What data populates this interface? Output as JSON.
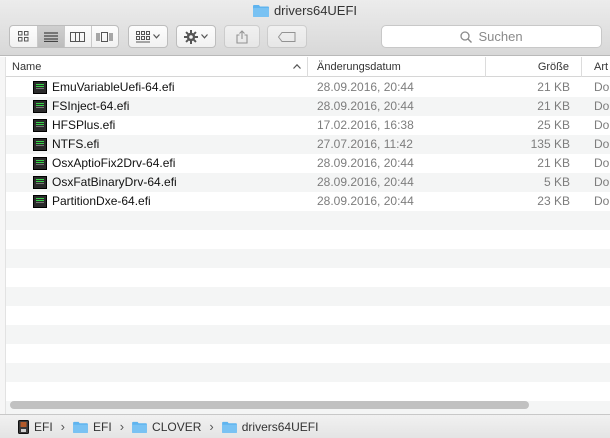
{
  "window": {
    "title": "drivers64UEFI"
  },
  "search": {
    "placeholder": "Suchen"
  },
  "columns": {
    "name": "Name",
    "date": "Änderungsdatum",
    "size": "Größe",
    "kind": "Art"
  },
  "files": [
    {
      "name": "EmuVariableUefi-64.efi",
      "date": "28.09.2016, 20:44",
      "size": "21 KB",
      "kind": "Do"
    },
    {
      "name": "FSInject-64.efi",
      "date": "28.09.2016, 20:44",
      "size": "21 KB",
      "kind": "Do"
    },
    {
      "name": "HFSPlus.efi",
      "date": "17.02.2016, 16:38",
      "size": "25 KB",
      "kind": "Do"
    },
    {
      "name": "NTFS.efi",
      "date": "27.07.2016, 11:42",
      "size": "135 KB",
      "kind": "Do"
    },
    {
      "name": "OsxAptioFix2Drv-64.efi",
      "date": "28.09.2016, 20:44",
      "size": "21 KB",
      "kind": "Do"
    },
    {
      "name": "OsxFatBinaryDrv-64.efi",
      "date": "28.09.2016, 20:44",
      "size": "5 KB",
      "kind": "Do"
    },
    {
      "name": "PartitionDxe-64.efi",
      "date": "28.09.2016, 20:44",
      "size": "23 KB",
      "kind": "Do"
    }
  ],
  "pathbar": [
    {
      "label": "EFI",
      "icon": "disk-icon"
    },
    {
      "label": "EFI",
      "icon": "folder-icon"
    },
    {
      "label": "CLOVER",
      "icon": "folder-icon"
    },
    {
      "label": "drivers64UEFI",
      "icon": "folder-icon"
    }
  ],
  "colors": {
    "folder": "#5fb4ef",
    "row_alt": "#f4f5f5",
    "selected_segment": "#c6c6c6"
  }
}
